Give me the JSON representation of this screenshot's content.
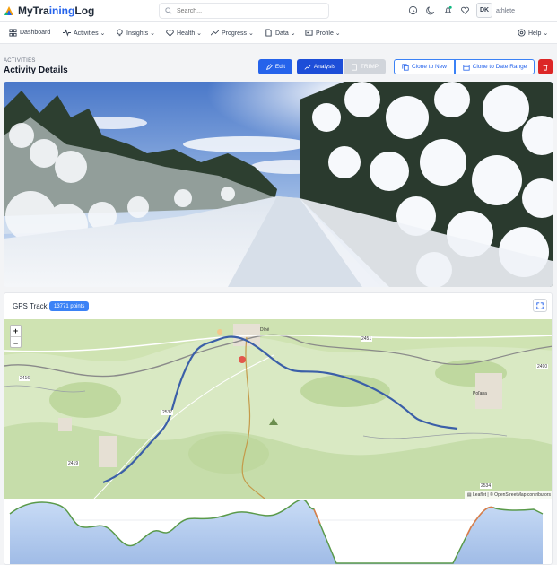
{
  "app": {
    "name_part1": "MyTra",
    "name_part2": "ining",
    "name_part3": "Log"
  },
  "search": {
    "placeholder": "Search..."
  },
  "user": {
    "initials": "DK",
    "name": "athlete"
  },
  "nav": {
    "items": [
      {
        "label": "Dashboard",
        "icon": "grid-icon"
      },
      {
        "label": "Activities ⌄",
        "icon": "activity-icon"
      },
      {
        "label": "Insights ⌄",
        "icon": "bulb-icon"
      },
      {
        "label": "Health ⌄",
        "icon": "heart-pulse-icon"
      },
      {
        "label": "Progress ⌄",
        "icon": "trend-icon"
      },
      {
        "label": "Data ⌄",
        "icon": "file-icon"
      },
      {
        "label": "Profile ⌄",
        "icon": "id-card-icon"
      }
    ],
    "help": "Help ⌄"
  },
  "page": {
    "breadcrumb": "ACTIVITIES",
    "title": "Activity Details"
  },
  "actions": {
    "edit": "Edit",
    "analysis": "Analysis",
    "trimp": "TRIMP",
    "clone_new": "Clone to New",
    "clone_range": "Clone to Date Range"
  },
  "gps": {
    "title": "GPS Track",
    "points": "13771 points"
  },
  "map": {
    "zoom_in": "+",
    "zoom_out": "−",
    "attribution": "▤ Leaflet | © OpenStreetMap contributors",
    "labels": [
      "Dlhé",
      "Poľana",
      "2451",
      "2416",
      "2537",
      "2534",
      "2419",
      "2490"
    ]
  },
  "colors": {
    "primary": "#2563eb",
    "danger": "#dc2626",
    "track": "#3b5fa8",
    "map_green": "#cfe3b2",
    "elevation_fill": "#bcd3f4"
  }
}
